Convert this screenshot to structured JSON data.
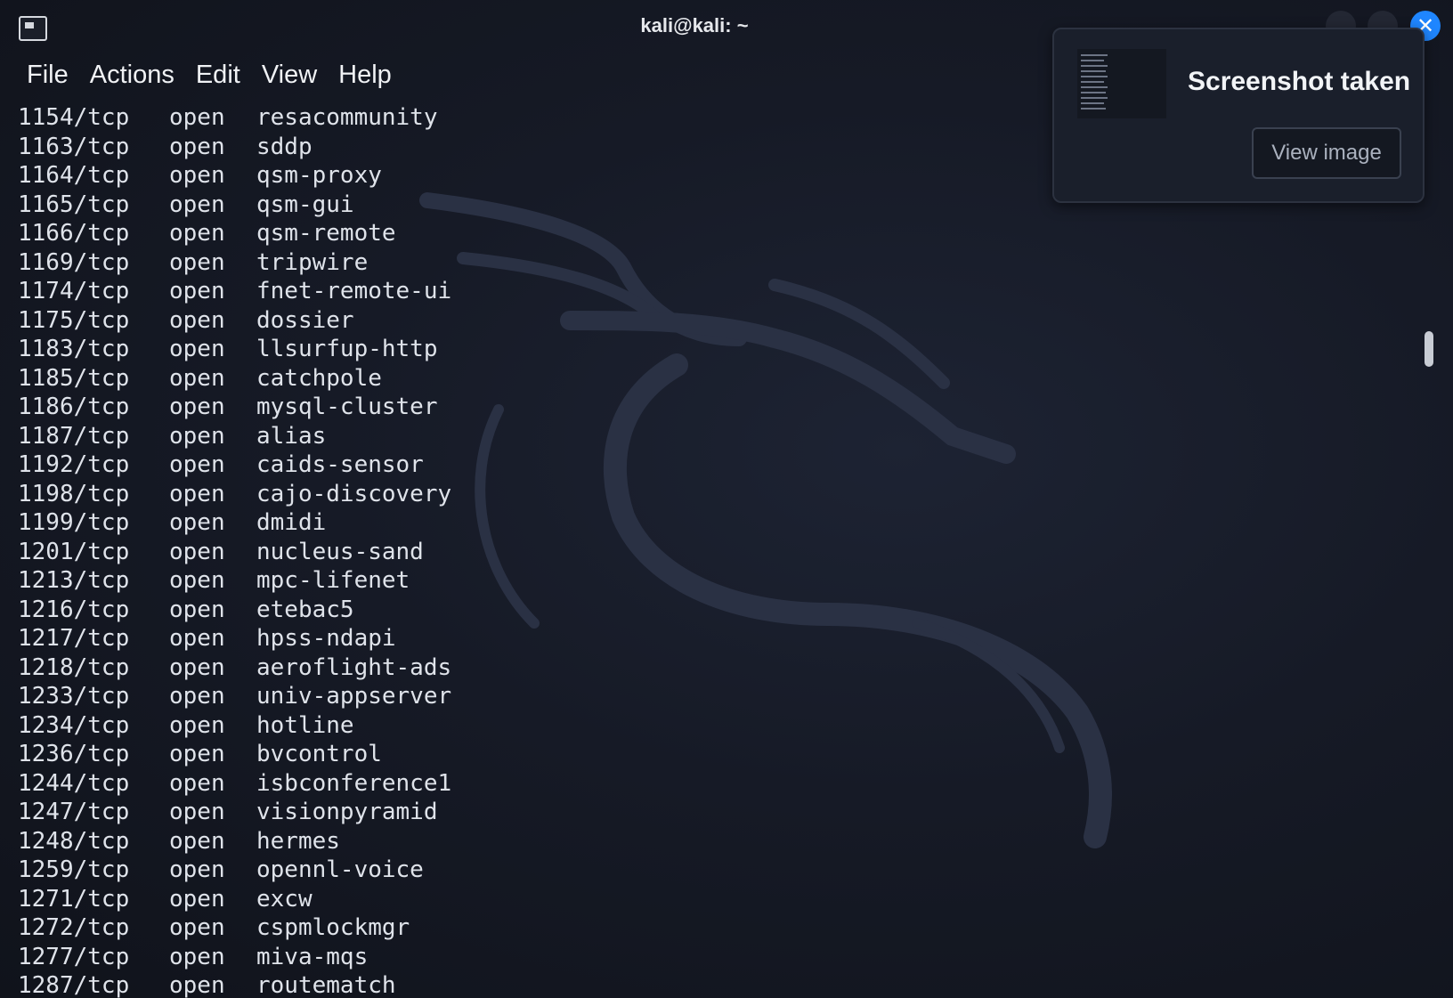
{
  "window": {
    "title": "kali@kali: ~",
    "accent_color": "#1f86ff"
  },
  "menu": [
    {
      "label": "File"
    },
    {
      "label": "Actions"
    },
    {
      "label": "Edit"
    },
    {
      "label": "View"
    },
    {
      "label": "Help"
    }
  ],
  "terminal": {
    "lines": [
      {
        "port": "1154/tcp",
        "state": "open",
        "service": "resacommunity"
      },
      {
        "port": "1163/tcp",
        "state": "open",
        "service": "sddp"
      },
      {
        "port": "1164/tcp",
        "state": "open",
        "service": "qsm-proxy"
      },
      {
        "port": "1165/tcp",
        "state": "open",
        "service": "qsm-gui"
      },
      {
        "port": "1166/tcp",
        "state": "open",
        "service": "qsm-remote"
      },
      {
        "port": "1169/tcp",
        "state": "open",
        "service": "tripwire"
      },
      {
        "port": "1174/tcp",
        "state": "open",
        "service": "fnet-remote-ui"
      },
      {
        "port": "1175/tcp",
        "state": "open",
        "service": "dossier"
      },
      {
        "port": "1183/tcp",
        "state": "open",
        "service": "llsurfup-http"
      },
      {
        "port": "1185/tcp",
        "state": "open",
        "service": "catchpole"
      },
      {
        "port": "1186/tcp",
        "state": "open",
        "service": "mysql-cluster"
      },
      {
        "port": "1187/tcp",
        "state": "open",
        "service": "alias"
      },
      {
        "port": "1192/tcp",
        "state": "open",
        "service": "caids-sensor"
      },
      {
        "port": "1198/tcp",
        "state": "open",
        "service": "cajo-discovery"
      },
      {
        "port": "1199/tcp",
        "state": "open",
        "service": "dmidi"
      },
      {
        "port": "1201/tcp",
        "state": "open",
        "service": "nucleus-sand"
      },
      {
        "port": "1213/tcp",
        "state": "open",
        "service": "mpc-lifenet"
      },
      {
        "port": "1216/tcp",
        "state": "open",
        "service": "etebac5"
      },
      {
        "port": "1217/tcp",
        "state": "open",
        "service": "hpss-ndapi"
      },
      {
        "port": "1218/tcp",
        "state": "open",
        "service": "aeroflight-ads"
      },
      {
        "port": "1233/tcp",
        "state": "open",
        "service": "univ-appserver"
      },
      {
        "port": "1234/tcp",
        "state": "open",
        "service": "hotline"
      },
      {
        "port": "1236/tcp",
        "state": "open",
        "service": "bvcontrol"
      },
      {
        "port": "1244/tcp",
        "state": "open",
        "service": "isbconference1"
      },
      {
        "port": "1247/tcp",
        "state": "open",
        "service": "visionpyramid"
      },
      {
        "port": "1248/tcp",
        "state": "open",
        "service": "hermes"
      },
      {
        "port": "1259/tcp",
        "state": "open",
        "service": "opennl-voice"
      },
      {
        "port": "1271/tcp",
        "state": "open",
        "service": "excw"
      },
      {
        "port": "1272/tcp",
        "state": "open",
        "service": "cspmlockmgr"
      },
      {
        "port": "1277/tcp",
        "state": "open",
        "service": "miva-mqs"
      },
      {
        "port": "1287/tcp",
        "state": "open",
        "service": "routematch"
      }
    ]
  },
  "notification": {
    "title": "Screenshot taken",
    "button_label": "View image"
  },
  "icons": {
    "app": "terminal-icon",
    "close": "close-icon",
    "minimize": "minimize-icon",
    "maximize": "maximize-icon"
  }
}
